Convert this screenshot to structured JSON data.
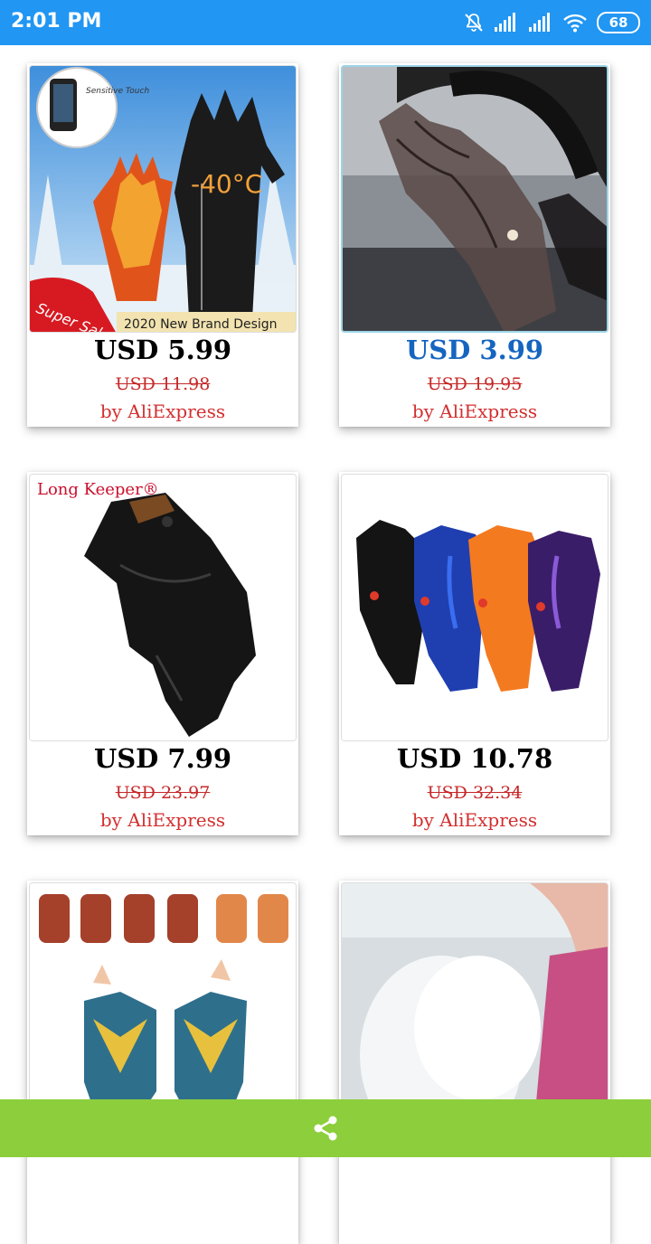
{
  "status_bar": {
    "time": "2:01 PM",
    "battery": "68"
  },
  "products": [
    {
      "price": "USD 5.99",
      "old_price": "USD 11.98",
      "seller": "by AliExpress",
      "image_banner": "2020 New Brand Design",
      "image_badge": "Super Sales",
      "image_temp": "-40°C",
      "image_touch": "Sensitive Touch"
    },
    {
      "price": "USD 3.99",
      "old_price": "USD 19.95",
      "seller": "by AliExpress"
    },
    {
      "price": "USD 7.99",
      "old_price": "USD 23.97",
      "seller": "by AliExpress",
      "image_brand": "Long Keeper®"
    },
    {
      "price": "USD 10.78",
      "old_price": "USD 32.34",
      "seller": "by AliExpress"
    },
    {
      "price": "",
      "old_price": "",
      "seller": ""
    },
    {
      "price": "",
      "old_price": "",
      "seller": ""
    }
  ],
  "colors": {
    "status_bar": "#2196f3",
    "bottom_bar": "#8dce3c",
    "price_selected": "#1565c0",
    "old_price": "#c62828"
  },
  "icons": {
    "bottom": "share-icon"
  }
}
